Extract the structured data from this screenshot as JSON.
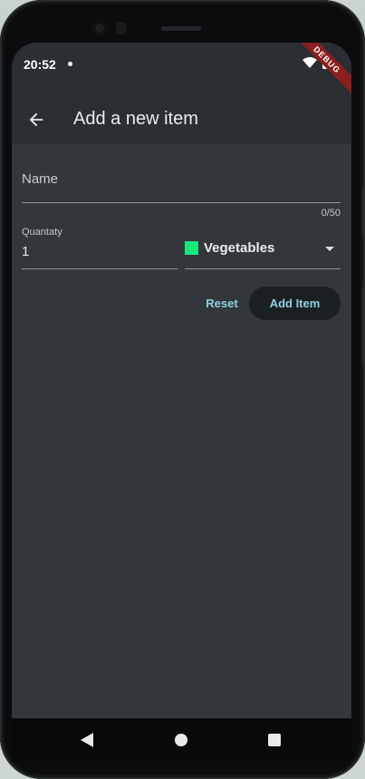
{
  "status_bar": {
    "time": "20:52",
    "debug_banner": "DEBUG"
  },
  "app_bar": {
    "title": "Add a new item",
    "back_icon": "arrow-back-icon"
  },
  "form": {
    "name_field": {
      "label": "Name",
      "value": "",
      "counter": "0/50"
    },
    "quantity_field": {
      "label": "Quantaty",
      "value": "1"
    },
    "category_dropdown": {
      "selected": "Vegetables",
      "swatch_color": "#18e67a"
    },
    "reset_label": "Reset",
    "submit_label": "Add Item"
  },
  "colors": {
    "background": "#31373a",
    "app_bar": "#2b2f33",
    "accent_text": "#8fd0e3"
  }
}
